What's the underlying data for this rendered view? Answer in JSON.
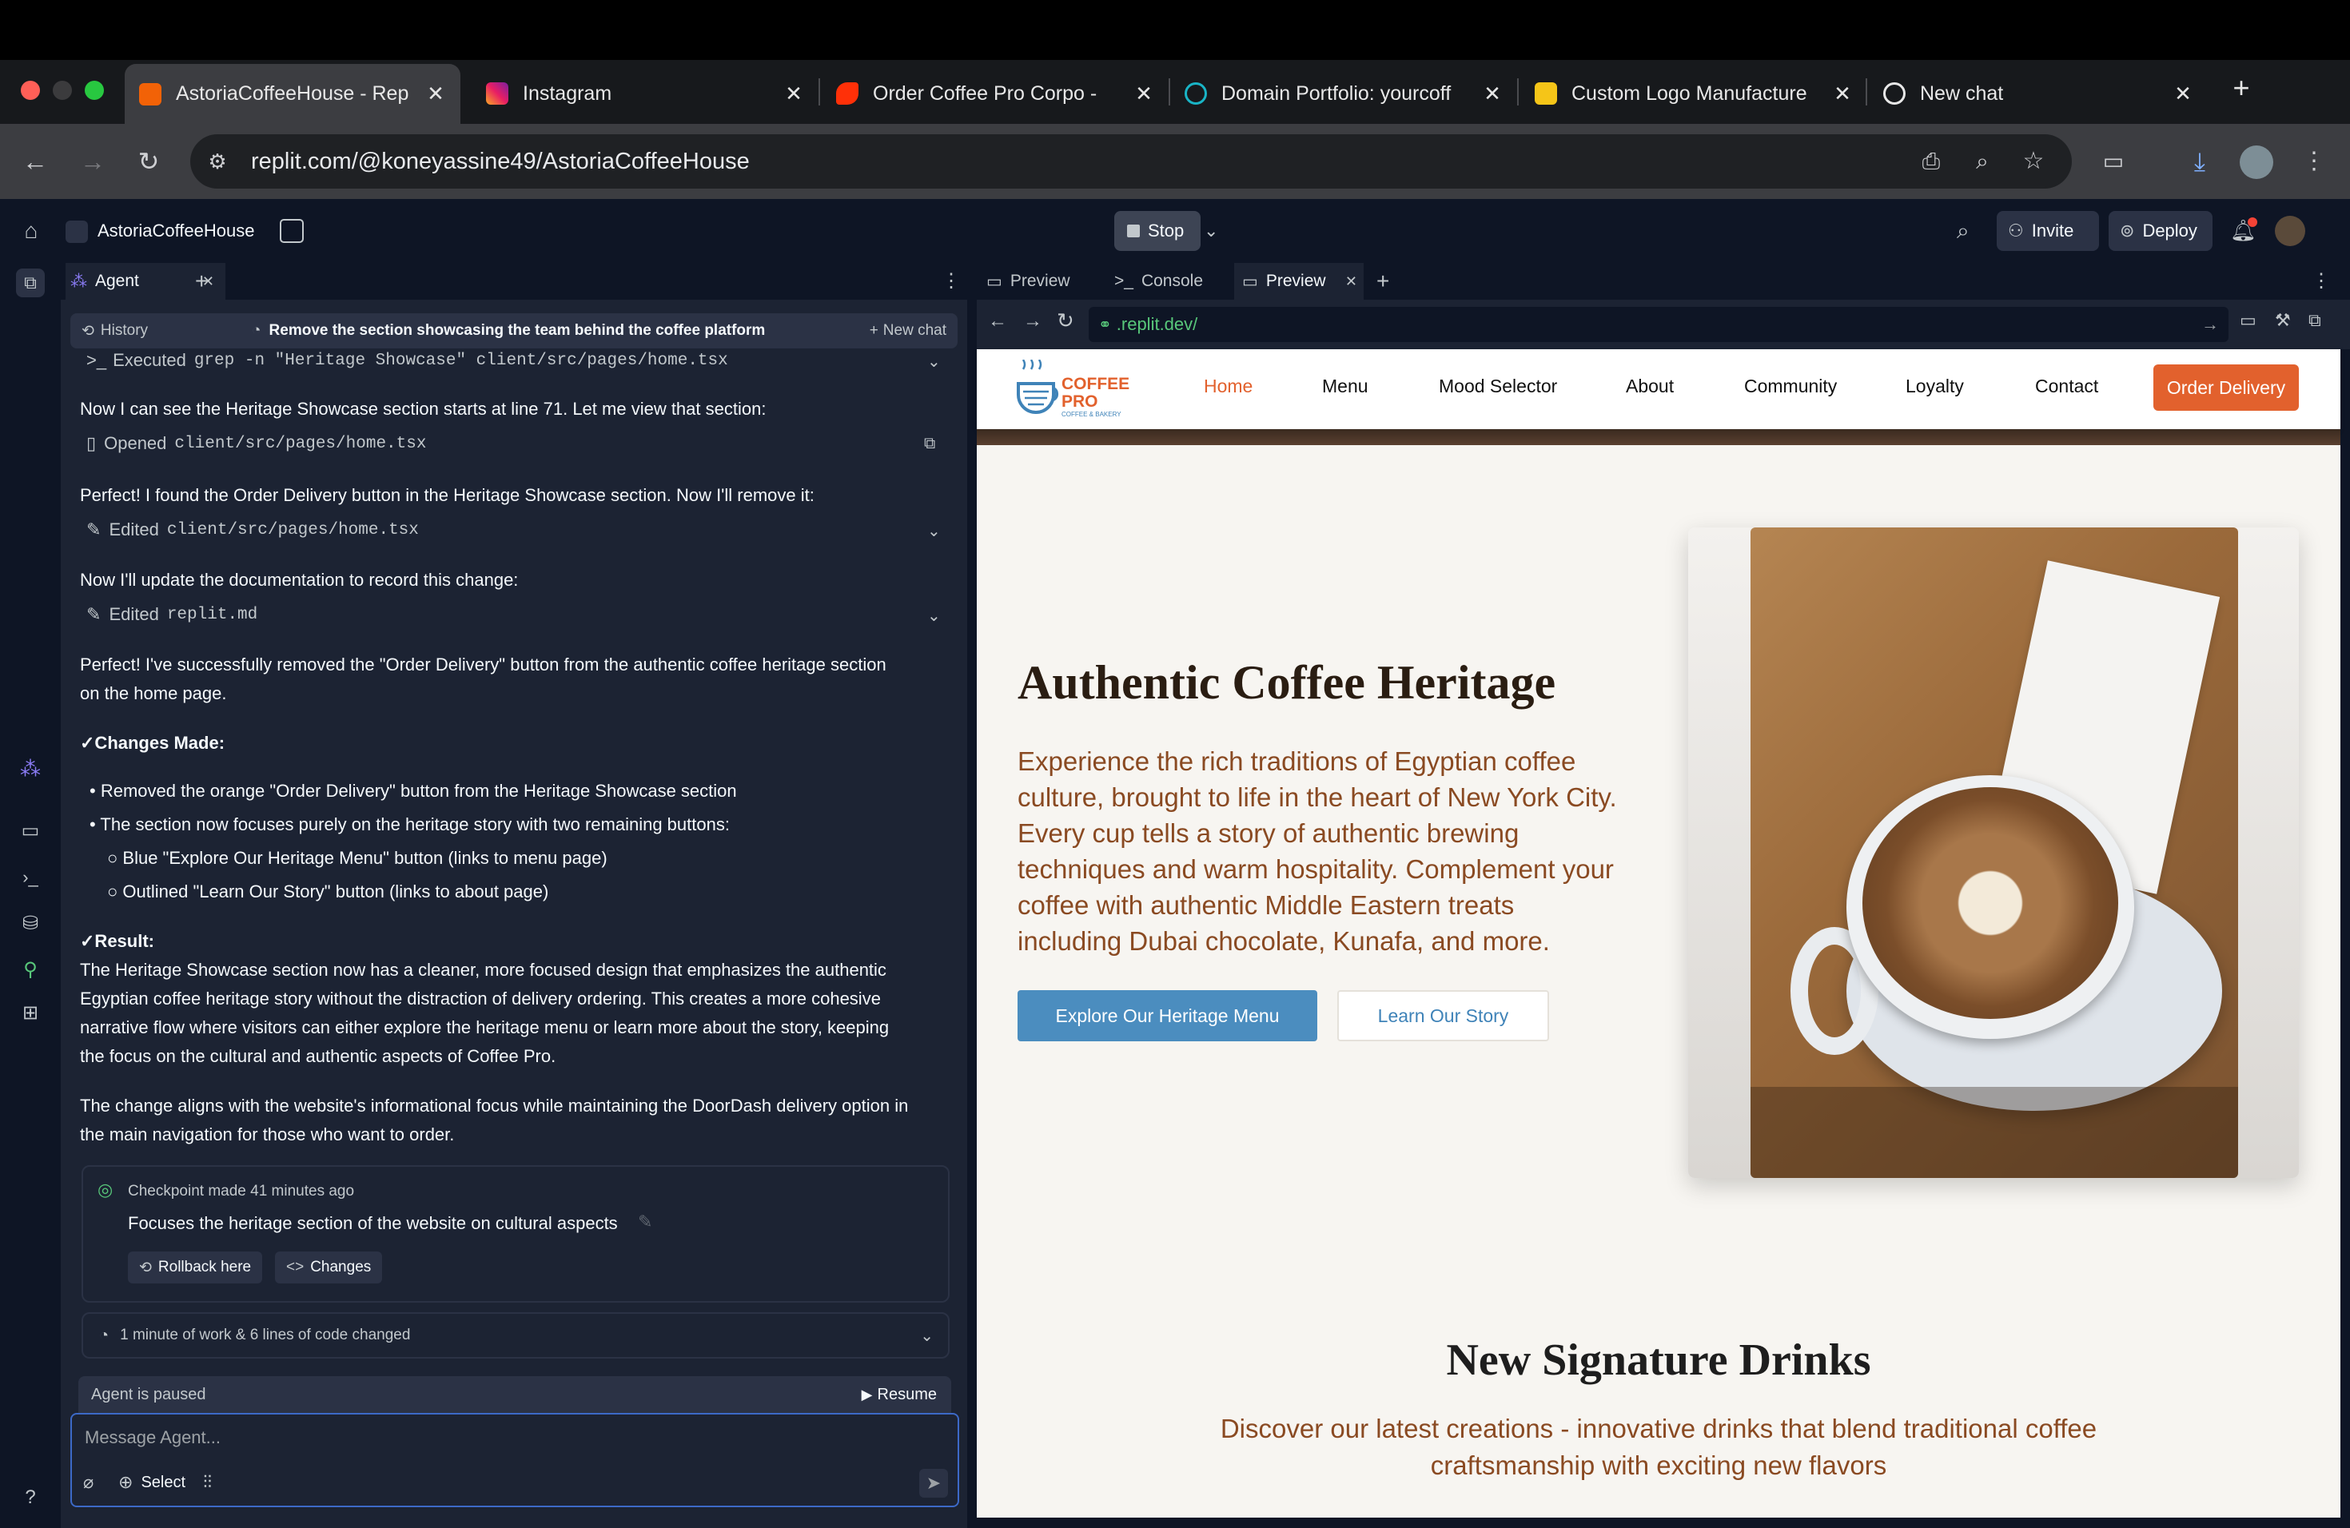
{
  "browser": {
    "tabs": [
      {
        "title": "AstoriaCoffeeHouse - Rep",
        "active": true
      },
      {
        "title": "Instagram"
      },
      {
        "title": "Order Coffee Pro Corpo -"
      },
      {
        "title": "Domain Portfolio: yourcoff"
      },
      {
        "title": "Custom Logo Manufacture"
      },
      {
        "title": "New chat"
      }
    ],
    "url": "replit.com/@koneyassine49/AstoriaCoffeeHouse"
  },
  "workspace": {
    "project_name": "AstoriaCoffeeHouse",
    "stop_label": "Stop",
    "invite_label": "Invite",
    "deploy_label": "Deploy"
  },
  "left_pane": {
    "tab_label": "Agent",
    "history_label": "History",
    "task_title": "Remove the section showcasing the team behind the coffee platform",
    "new_chat_label": "New chat",
    "messages": {
      "executed_prefix": "Executed",
      "executed_cmd": "grep -n \"Heritage Showcase\" client/src/pages/home.tsx",
      "m1": "Now I can see the Heritage Showcase section starts at line 71. Let me view that section:",
      "opened_prefix": "Opened",
      "opened_file": "client/src/pages/home.tsx",
      "m2": "Perfect! I found the Order Delivery button in the Heritage Showcase section. Now I'll remove it:",
      "edited1_prefix": "Edited",
      "edited1_file": "client/src/pages/home.tsx",
      "m3": "Now I'll update the documentation to record this change:",
      "edited2_prefix": "Edited",
      "edited2_file": "replit.md",
      "m4a": "Perfect! I've successfully removed the \"Order Delivery\" button from the authentic coffee heritage section",
      "m4b": "on the home page.",
      "changes_heading": "✓Changes Made:",
      "bullet1": "Removed the orange \"Order Delivery\" button from the Heritage Showcase section",
      "bullet2": "The section now focuses purely on the heritage story with two remaining buttons:",
      "sub1": "Blue \"Explore Our Heritage Menu\" button (links to menu page)",
      "sub2": "Outlined \"Learn Our Story\" button (links to about page)",
      "result_heading": "✓Result:",
      "result1": "The Heritage Showcase section now has a cleaner, more focused design that emphasizes the authentic",
      "result2": "Egyptian coffee heritage story without the distraction of delivery ordering. This creates a more cohesive",
      "result3": "narrative flow where visitors can either explore the heritage menu or learn more about the story, keeping",
      "result4": "the focus on the cultural and authentic aspects of Coffee Pro.",
      "m5a": "The change aligns with the website's informational focus while maintaining the DoorDash delivery option in",
      "m5b": "the main navigation for those who want to order."
    },
    "checkpoint": {
      "meta": "Checkpoint made 41 minutes ago",
      "title": "Focuses the heritage section of the website on cultural aspects",
      "rollback_label": "Rollback here",
      "changes_label": "Changes"
    },
    "work_summary": "1 minute of work & 6 lines of code changed",
    "paused_text": "Agent is paused",
    "resume_label": "Resume",
    "input_placeholder": "Message Agent...",
    "select_label": "Select"
  },
  "right_pane": {
    "tabs": [
      "Preview",
      "Console",
      "Preview"
    ],
    "preview_url": ".replit.dev/"
  },
  "site": {
    "logo_line1": "COFFEE",
    "logo_line2": "PRO",
    "logo_tagline": "COFFEE & BAKERY",
    "nav": [
      "Home",
      "Menu",
      "Mood Selector",
      "About",
      "Community",
      "Loyalty",
      "Contact"
    ],
    "order_button": "Order Delivery",
    "hero_title": "Authentic Coffee Heritage",
    "hero_text": "Experience the rich traditions of Egyptian coffee culture, brought to life in the heart of New York City. Every cup tells a story of authentic brewing techniques and warm hospitality. Complement your coffee with authentic Middle Eastern treats including Dubai chocolate, Kunafa, and more.",
    "primary_button": "Explore Our Heritage Menu",
    "secondary_button": "Learn Our Story",
    "section_title": "New Signature Drinks",
    "section_text": "Discover our latest creations - innovative drinks that blend traditional coffee craftsmanship with exciting new flavors",
    "colors": {
      "accent": "#e2612d",
      "blue": "#4b8dbf",
      "brown": "#8a4a22"
    }
  }
}
